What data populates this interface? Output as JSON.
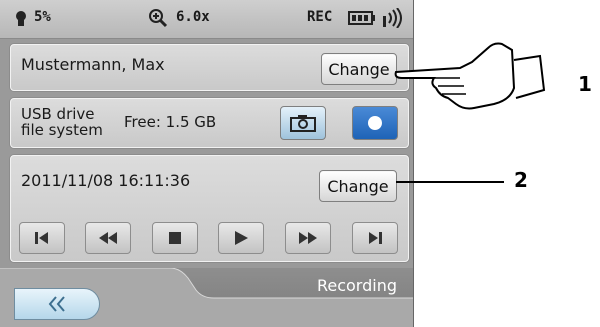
{
  "status": {
    "battery_text": "5%",
    "zoom": "6.0x",
    "rec": "REC"
  },
  "recipient": {
    "name": "Mustermann, Max",
    "change_label": "Change"
  },
  "storage": {
    "line1": "USB drive",
    "line2": "file system",
    "free": "Free: 1.5 GB"
  },
  "datetime": {
    "value": "2011/11/08 16:11:36",
    "change_label": "Change"
  },
  "footer": {
    "label": "Recording"
  },
  "callouts": [
    "1",
    "2"
  ],
  "icons": [
    "bulb-icon",
    "zoom-icon",
    "battery-icon",
    "signal-icon",
    "camera-icon",
    "record-dot-icon",
    "skip-start-icon",
    "rewind-icon",
    "stop-icon",
    "play-icon",
    "fast-forward-icon",
    "skip-end-icon",
    "double-chevron-left-icon",
    "pointing-hand-icon"
  ],
  "colors": {
    "record_button": "#1e63b7",
    "back_button": "#b5d7ea"
  }
}
